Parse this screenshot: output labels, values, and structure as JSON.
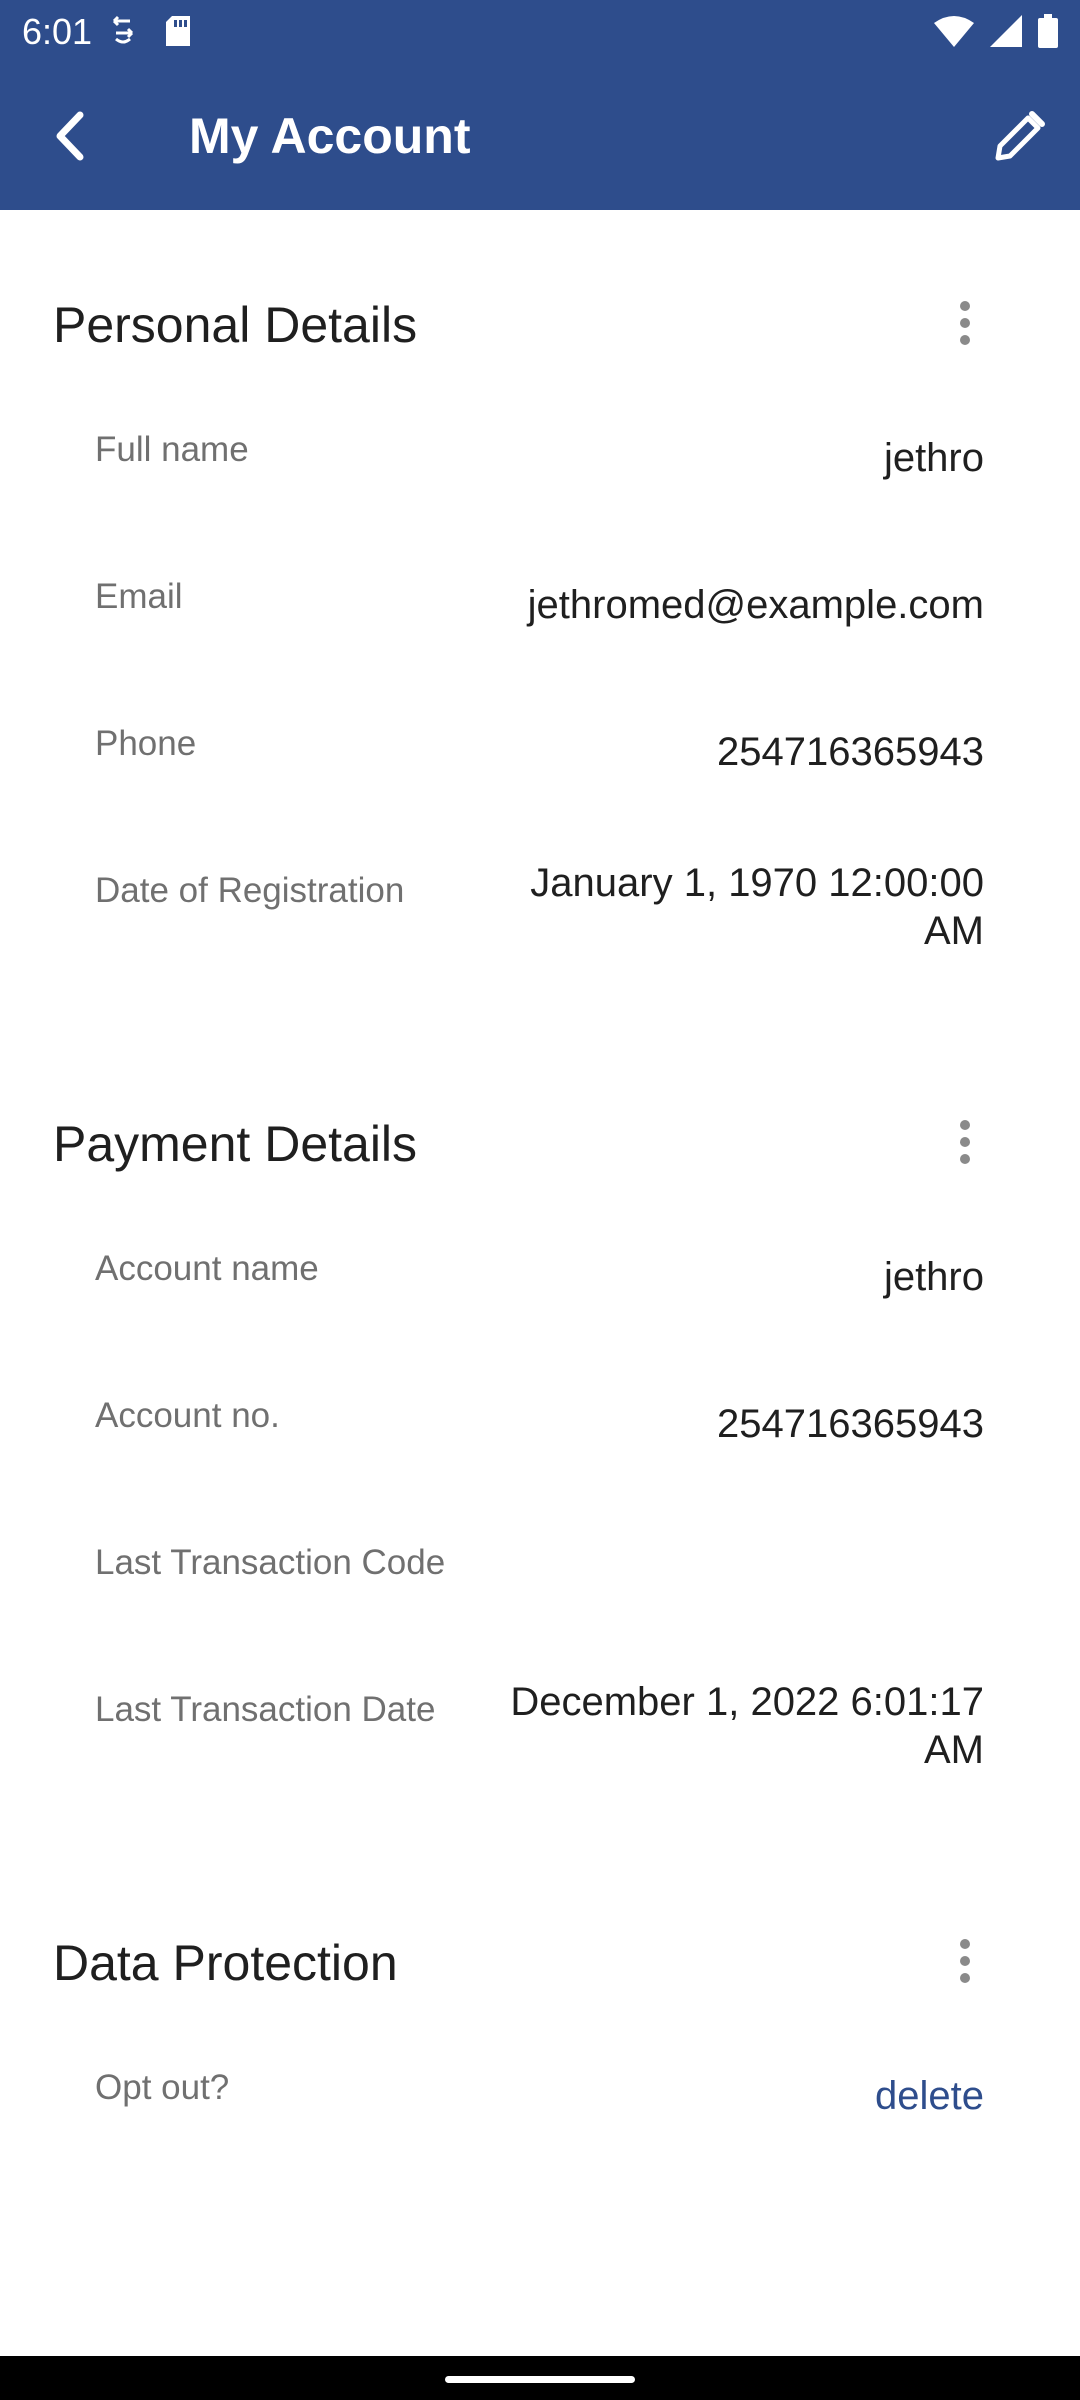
{
  "status_bar": {
    "time": "6:01",
    "left_icons": [
      "sync-icon",
      "sd-card-icon"
    ],
    "right_icons": [
      "wifi-icon",
      "signal-icon",
      "battery-icon"
    ]
  },
  "app_bar": {
    "title": "My Account",
    "back_icon": "back-arrow-icon",
    "edit_icon": "pencil-icon",
    "color": "#2e4d8c"
  },
  "sections": {
    "personal": {
      "title": "Personal Details",
      "rows": [
        {
          "label": "Full name",
          "value": "jethro"
        },
        {
          "label": "Email",
          "value": "jethromed@example.com"
        },
        {
          "label": "Phone",
          "value": "254716365943"
        },
        {
          "label": "Date of Registration",
          "value": "January 1, 1970 12:00:00 AM"
        }
      ]
    },
    "payment": {
      "title": "Payment Details",
      "rows": [
        {
          "label": "Account name",
          "value": "jethro"
        },
        {
          "label": "Account no.",
          "value": "254716365943"
        },
        {
          "label": "Last Transaction Code",
          "value": ""
        },
        {
          "label": "Last Transaction Date",
          "value": "December 1, 2022 6:01:17 AM"
        }
      ]
    },
    "data_protection": {
      "title": "Data Protection",
      "rows": [
        {
          "label": "Opt out?",
          "value": "delete"
        }
      ]
    }
  },
  "colors": {
    "accent": "#2e4d8c",
    "label": "#707070",
    "text": "#1f1f1f"
  }
}
